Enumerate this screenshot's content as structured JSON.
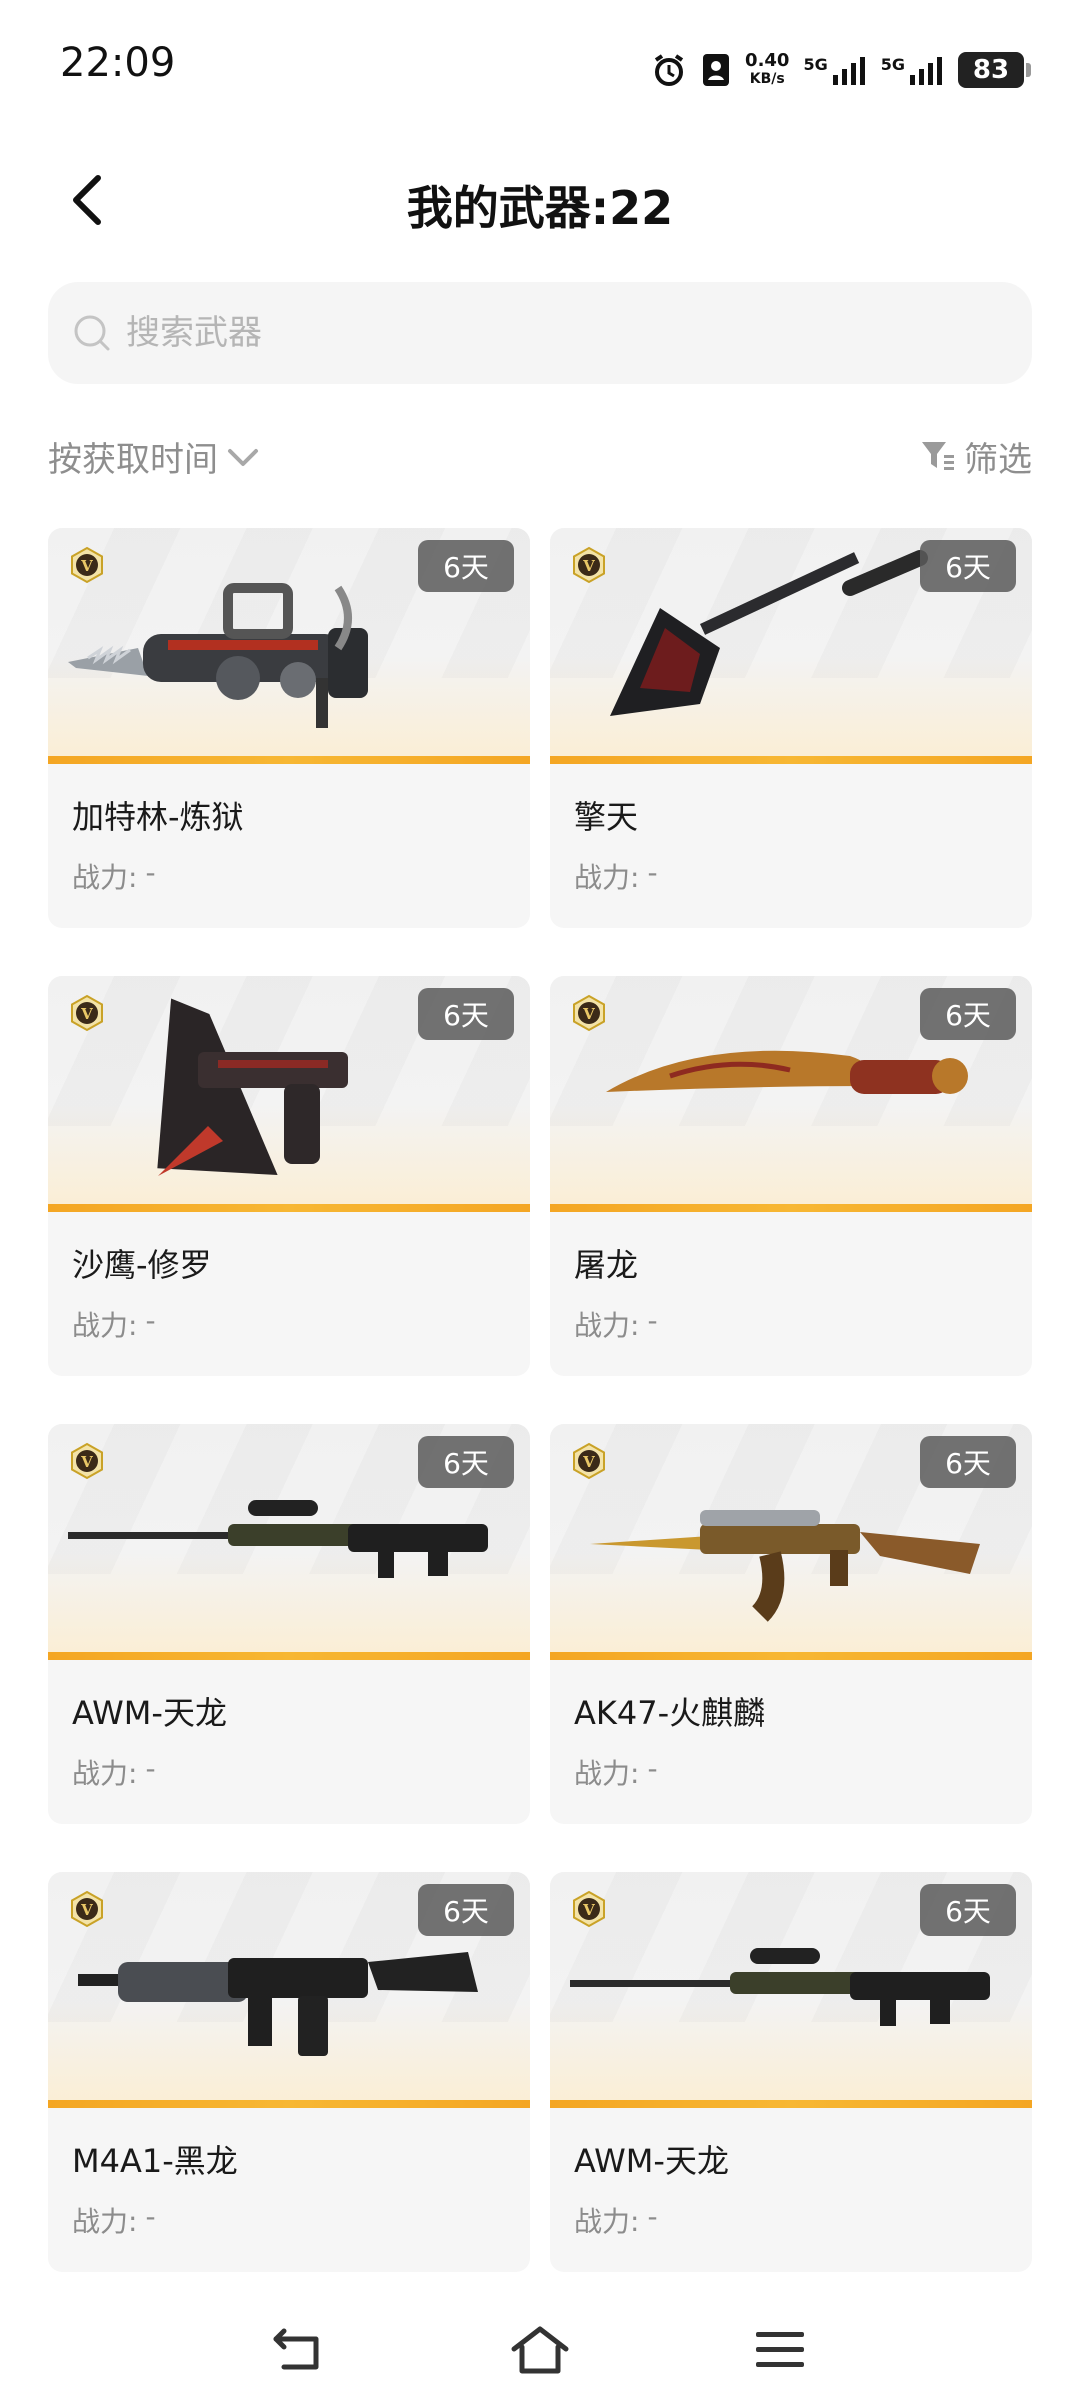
{
  "status_bar": {
    "time": "22:09",
    "net_speed_value": "0.40",
    "net_speed_unit": "KB/s",
    "signal1_label": "5G",
    "signal2_label": "5G",
    "battery": "83"
  },
  "header": {
    "title": "我的武器:22"
  },
  "search": {
    "placeholder": "搜索武器"
  },
  "toolbar": {
    "sort_label": "按获取时间",
    "filter_label": "筛选"
  },
  "cards": [
    {
      "name": "加特林-炼狱",
      "days": "6天",
      "power_label": "战力:",
      "power_value": "-",
      "badge": "V",
      "icon": "gatling-gun-icon"
    },
    {
      "name": "擎天",
      "days": "6天",
      "power_label": "战力:",
      "power_value": "-",
      "badge": "V",
      "icon": "shovel-weapon-icon"
    },
    {
      "name": "沙鹰-修罗",
      "days": "6天",
      "power_label": "战力:",
      "power_value": "-",
      "badge": "V",
      "icon": "desert-eagle-pistol-icon"
    },
    {
      "name": "屠龙",
      "days": "6天",
      "power_label": "战力:",
      "power_value": "-",
      "badge": "V",
      "icon": "kukri-knife-icon"
    },
    {
      "name": "AWM-天龙",
      "days": "6天",
      "power_label": "战力:",
      "power_value": "-",
      "badge": "V",
      "icon": "sniper-rifle-icon"
    },
    {
      "name": "AK47-火麒麟",
      "days": "6天",
      "power_label": "战力:",
      "power_value": "-",
      "badge": "V",
      "icon": "ak47-rifle-icon"
    },
    {
      "name": "M4A1-黑龙",
      "days": "6天",
      "power_label": "战力:",
      "power_value": "-",
      "badge": "V",
      "icon": "m4a1-rifle-icon"
    },
    {
      "name": "AWM-天龙",
      "days": "6天",
      "power_label": "战力:",
      "power_value": "-",
      "badge": "V",
      "icon": "sniper-rifle-icon"
    }
  ],
  "colors": {
    "accent_bar": "#f4a623",
    "badge_gold": "#c9a227",
    "card_bg": "#f6f6f6"
  }
}
